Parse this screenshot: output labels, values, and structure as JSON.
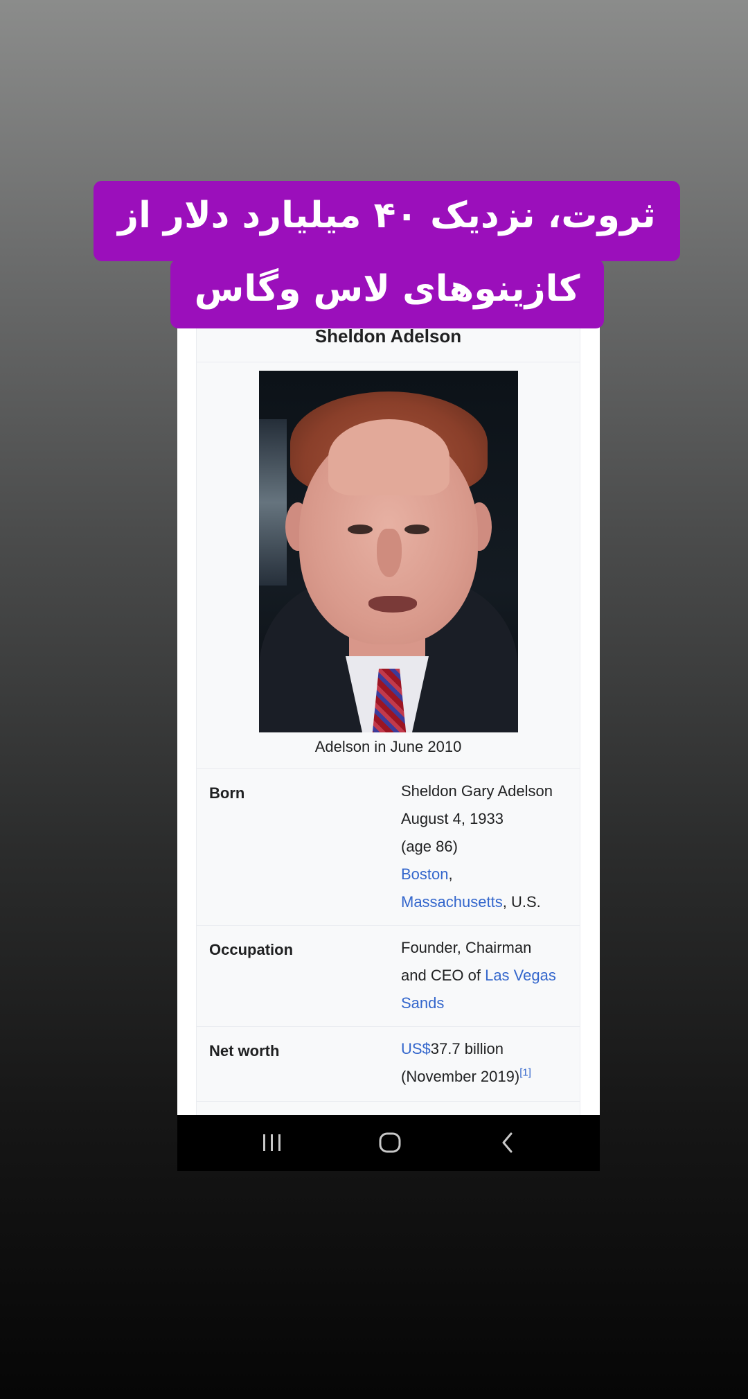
{
  "overlay": {
    "line1": "ثروت، نزدیک ۴۰ میلیارد دلار از",
    "line2": "کازینوهای لاس وگاس"
  },
  "infobox": {
    "title": "Sheldon Adelson",
    "caption": "Adelson in June 2010",
    "born": {
      "label": "Born",
      "name": "Sheldon Gary Adelson",
      "date": "August 4, 1933",
      "age": "(age 86)",
      "place_link1": "Boston",
      "place_sep": ",",
      "place_link2": "Massachusetts",
      "place_suffix": ", U.S."
    },
    "occupation": {
      "label": "Occupation",
      "line1": "Founder, Chairman",
      "line2_prefix": "and CEO of ",
      "link_part1": "Las Vegas",
      "link_part2": "Sands"
    },
    "net_worth": {
      "label": "Net worth",
      "currency_link": "US$",
      "amount": "37.7 billion",
      "date": "(November 2019)",
      "ref": "[1]"
    }
  },
  "navbar": {
    "icons": [
      "recent-apps-icon",
      "home-icon",
      "back-icon"
    ],
    "icon_color": "#c8c8c8"
  },
  "colors": {
    "overlay_background": "#9b0fbb",
    "link": "#3366cc"
  }
}
